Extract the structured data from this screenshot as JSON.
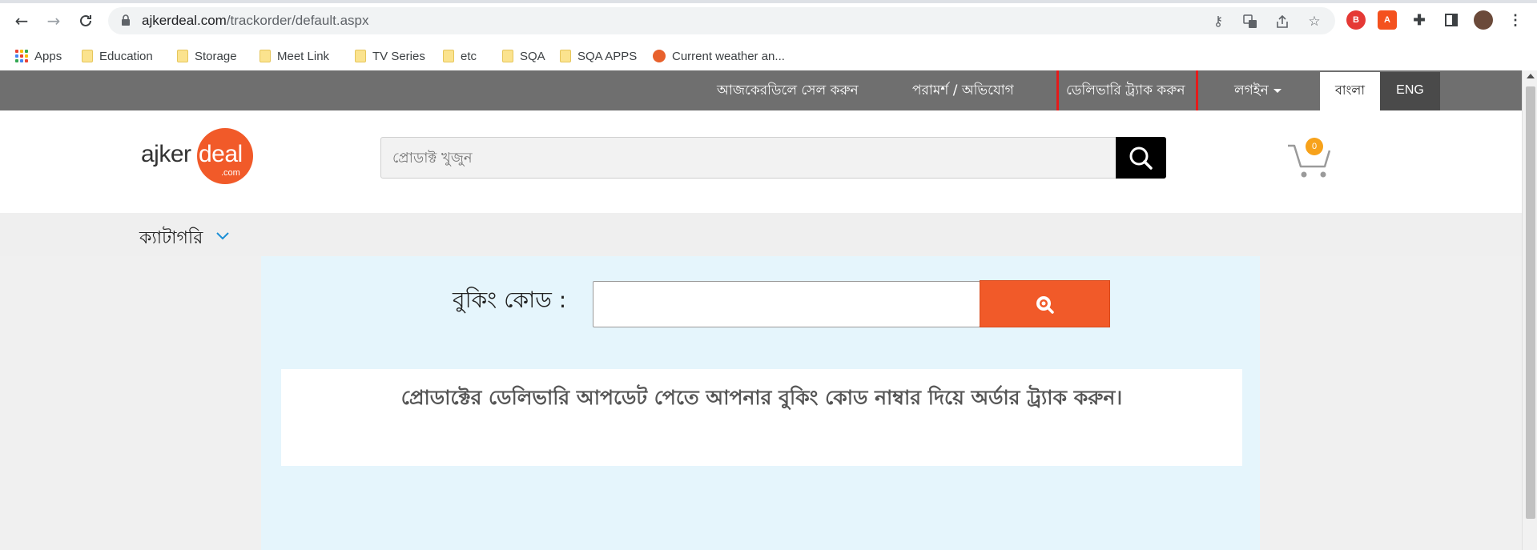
{
  "browser": {
    "url_domain": "ajkerdeal.com",
    "url_path": "/trackorder/default.aspx",
    "bookmarks": [
      {
        "label": "Apps",
        "icon": "apps-grid-icon"
      },
      {
        "label": "Education",
        "icon": "folder-icon"
      },
      {
        "label": "Storage",
        "icon": "folder-icon"
      },
      {
        "label": "Meet Link",
        "icon": "folder-icon"
      },
      {
        "label": "TV Series",
        "icon": "folder-icon"
      },
      {
        "label": "etc",
        "icon": "folder-icon"
      },
      {
        "label": "SQA",
        "icon": "folder-icon"
      },
      {
        "label": "SQA APPS",
        "icon": "folder-icon"
      },
      {
        "label": "Current weather an...",
        "icon": "weather-icon"
      }
    ]
  },
  "topnav": {
    "sell": "আজকেরডিলে সেল করুন",
    "feedback": "পরামর্শ / অভিযোগ",
    "track": "ডেলিভারি ট্র্যাক করুন",
    "login": "লগইন",
    "lang_bn": "বাংলা",
    "lang_en": "ENG"
  },
  "header": {
    "logo_left": "ajker",
    "logo_right": "deal",
    "logo_com": ".com",
    "search_placeholder": "প্রোডাক্ট খুজুন",
    "cart_count": "0"
  },
  "category": {
    "label": "ক্যাটাগরি"
  },
  "track": {
    "booking_label": "বুকিং কোড :",
    "booking_value": "",
    "info": "প্রোডাক্টের ডেলিভারি আপডেট পেতে আপনার বুকিং কোড নাম্বার দিয়ে অর্ডার ট্র্যাক করুন।"
  },
  "colors": {
    "brand_orange": "#f15a29",
    "topbar_gray": "#6f6f6f",
    "highlight_red": "#e41b1b"
  }
}
